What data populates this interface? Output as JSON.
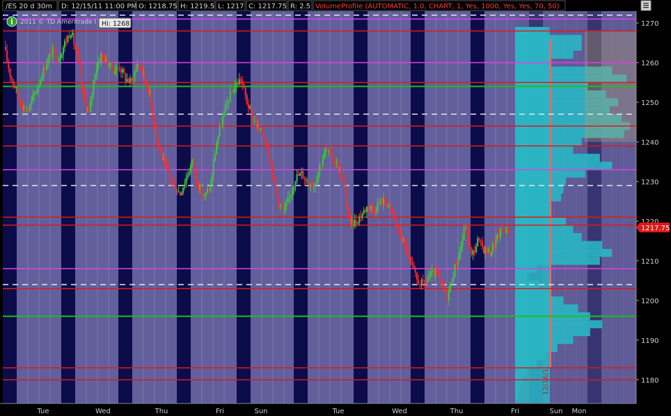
{
  "header": {
    "symbol": "/ES 20 d 30m",
    "date": "D: 12/15/11 11:00 PM",
    "open": "O: 1218.75",
    "high": "H: 1219.5",
    "low": "L: 1217",
    "close": "C: 1217.75",
    "range": "R: 2.5",
    "study": "VolumeProfile (AUTOMATIC, 1.0, CHART, 1, Yes, 1000, Yes, Yes, 70, 50)"
  },
  "watermark": "2011 © TD Ameritrade I                    y, Inc.",
  "hi_label": "Hi: 1268",
  "last_price_label": "1217.75",
  "vertical_date_label": "12/16/1",
  "colors": {
    "background": "#000000",
    "day_band": "#625f9c",
    "night_band": "#0c0c4a",
    "up_candle": "#3ec83e",
    "down_candle": "#ff2a2a",
    "red_level": "#e01818",
    "magenta_level": "#e040e0",
    "green_level": "#18c018",
    "white_dashed": "#e8e8e8",
    "volume_profile": "#2ab6c4",
    "value_area_edge": "#e86a6a"
  },
  "chart_data": {
    "type": "candlestick",
    "ylim": [
      1174,
      1273
    ],
    "y_ticks": [
      1180,
      1190,
      1200,
      1210,
      1220,
      1230,
      1240,
      1250,
      1260,
      1270
    ],
    "x_day_labels": [
      "Tue",
      "Wed",
      "Thu",
      "Fri",
      "Sun",
      "Tue",
      "Wed",
      "Thu",
      "Fri",
      "Sun",
      "Mon"
    ],
    "last_price": 1217.75,
    "session_high": 1268,
    "horizontal_levels": {
      "red": [
        1268,
        1255,
        1244,
        1239,
        1221,
        1219,
        1203,
        1183,
        1180
      ],
      "magenta": [
        1271,
        1260,
        1233,
        1208
      ],
      "green": [
        1254,
        1196
      ],
      "white_dashed": [
        1272,
        1247,
        1229,
        1204
      ]
    },
    "price_path": [
      1264,
      1257,
      1253,
      1249,
      1248,
      1252,
      1256,
      1260,
      1263,
      1261,
      1265,
      1268,
      1262,
      1252,
      1247,
      1258,
      1262,
      1260,
      1258,
      1259,
      1256,
      1255,
      1260,
      1257,
      1252,
      1242,
      1236,
      1232,
      1229,
      1227,
      1231,
      1235,
      1229,
      1226,
      1229,
      1240,
      1246,
      1251,
      1254,
      1256,
      1250,
      1246,
      1243,
      1241,
      1234,
      1226,
      1222,
      1226,
      1231,
      1232,
      1230,
      1229,
      1234,
      1238,
      1236,
      1234,
      1229,
      1219,
      1220,
      1222,
      1224,
      1223,
      1225,
      1225,
      1222,
      1217,
      1214,
      1209,
      1205,
      1204,
      1206,
      1207,
      1204,
      1201,
      1207,
      1212,
      1219,
      1211,
      1215,
      1213,
      1212,
      1215,
      1218,
      1217.75
    ],
    "volume_profile_bars": [
      {
        "price": 1268,
        "v": 0.25
      },
      {
        "price": 1266,
        "v": 0.55
      },
      {
        "price": 1264,
        "v": 0.55
      },
      {
        "price": 1262,
        "v": 0.48
      },
      {
        "price": 1260,
        "v": 0.3
      },
      {
        "price": 1258,
        "v": 0.8
      },
      {
        "price": 1256,
        "v": 0.92
      },
      {
        "price": 1254,
        "v": 0.6
      },
      {
        "price": 1252,
        "v": 0.75
      },
      {
        "price": 1250,
        "v": 0.85
      },
      {
        "price": 1248,
        "v": 0.78
      },
      {
        "price": 1246,
        "v": 0.88
      },
      {
        "price": 1244,
        "v": 0.95
      },
      {
        "price": 1242,
        "v": 0.9
      },
      {
        "price": 1240,
        "v": 0.55
      },
      {
        "price": 1238,
        "v": 0.48
      },
      {
        "price": 1236,
        "v": 0.7
      },
      {
        "price": 1234,
        "v": 0.8
      },
      {
        "price": 1232,
        "v": 0.58
      },
      {
        "price": 1230,
        "v": 0.42
      },
      {
        "price": 1228,
        "v": 0.4
      },
      {
        "price": 1226,
        "v": 0.38
      },
      {
        "price": 1224,
        "v": 0.3
      },
      {
        "price": 1222,
        "v": 0.3
      },
      {
        "price": 1220,
        "v": 0.42
      },
      {
        "price": 1218,
        "v": 0.48
      },
      {
        "price": 1216,
        "v": 0.55
      },
      {
        "price": 1214,
        "v": 0.72
      },
      {
        "price": 1212,
        "v": 0.8
      },
      {
        "price": 1210,
        "v": 0.7
      },
      {
        "price": 1208,
        "v": 0.18
      },
      {
        "price": 1206,
        "v": 0.1
      },
      {
        "price": 1204,
        "v": 0.2
      },
      {
        "price": 1202,
        "v": 0.28
      },
      {
        "price": 1200,
        "v": 0.4
      },
      {
        "price": 1198,
        "v": 0.52
      },
      {
        "price": 1196,
        "v": 0.62
      },
      {
        "price": 1194,
        "v": 0.72
      },
      {
        "price": 1192,
        "v": 0.62
      },
      {
        "price": 1190,
        "v": 0.48
      },
      {
        "price": 1188,
        "v": 0.35
      },
      {
        "price": 1186,
        "v": 0.25
      },
      {
        "price": 1184,
        "v": 0.18
      },
      {
        "price": 1182,
        "v": 0.1
      },
      {
        "price": 1180,
        "v": 0.06
      },
      {
        "price": 1178,
        "v": 0.04
      },
      {
        "price": 1176,
        "v": 0.03
      }
    ],
    "value_area": [
      1183,
      1266
    ]
  }
}
